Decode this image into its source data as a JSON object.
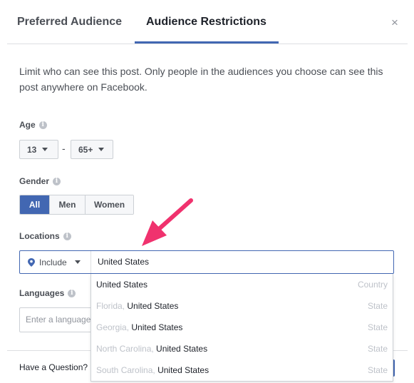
{
  "tabs": {
    "preferred": "Preferred Audience",
    "restrictions": "Audience Restrictions",
    "close": "×"
  },
  "description": "Limit who can see this post. Only people in the audiences you choose can see this post anywhere on Facebook.",
  "age": {
    "label": "Age",
    "min": "13",
    "max": "65+",
    "separator": "-"
  },
  "gender": {
    "label": "Gender",
    "options": [
      "All",
      "Men",
      "Women"
    ],
    "selected": "All"
  },
  "locations": {
    "label": "Locations",
    "mode": "Include",
    "value": "United States",
    "suggestions": [
      {
        "prefix": "",
        "name": "United States",
        "type": "Country"
      },
      {
        "prefix": "Florida, ",
        "name": "United States",
        "type": "State"
      },
      {
        "prefix": "Georgia, ",
        "name": "United States",
        "type": "State"
      },
      {
        "prefix": "North Carolina, ",
        "name": "United States",
        "type": "State"
      },
      {
        "prefix": "South Carolina, ",
        "name": "United States",
        "type": "State"
      }
    ]
  },
  "languages": {
    "label": "Languages",
    "placeholder": "Enter a language..."
  },
  "footer": {
    "question": "Have a Question?"
  },
  "colors": {
    "accent": "#4267b2",
    "annotation": "#f0326e"
  }
}
